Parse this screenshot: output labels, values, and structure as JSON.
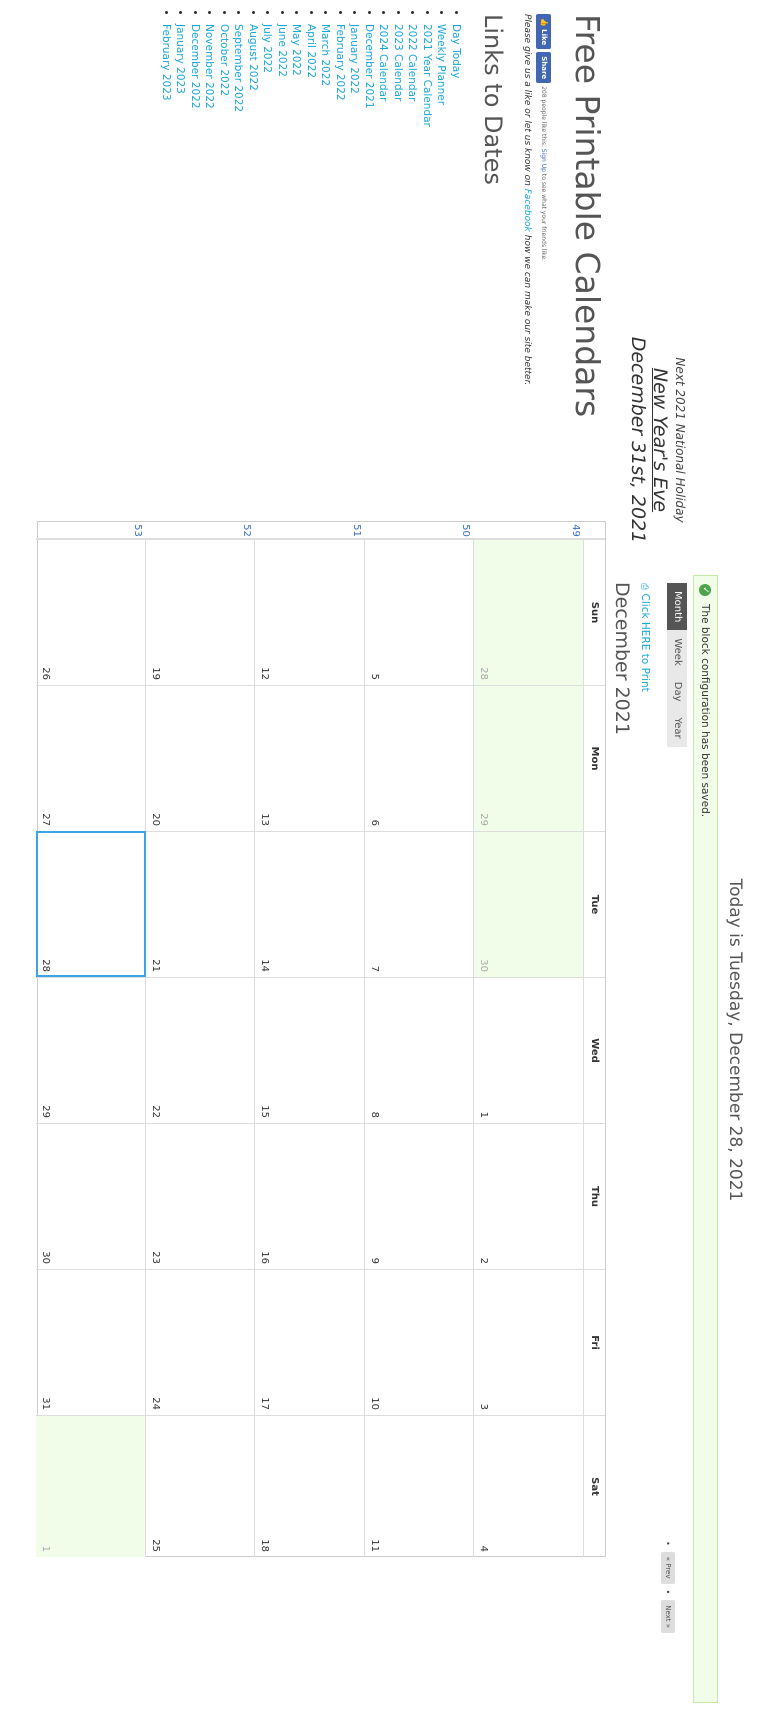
{
  "holiday": {
    "label": "Next 2021 National Holiday",
    "name": "New Year's Eve",
    "date": "December 31st, 2021"
  },
  "site_title": "Free Printable Calendars",
  "facebook": {
    "like_label": "Like",
    "share_label": "Share",
    "count_text": "208 people like this.",
    "signup_link": "Sign Up",
    "signup_suffix": "to see what your friends like."
  },
  "feedback": {
    "prefix": "Please give us a like or let us know on",
    "link": "Facebook",
    "suffix": "how we can make our site better."
  },
  "links_heading": "Links to Dates",
  "links": [
    "Day Today",
    "Weekly Planner",
    "2021 Year Calendar",
    "2022 Calendar",
    "2023 Calendar",
    "2024 Calendar",
    "December 2021",
    "January 2022",
    "February 2022",
    "March 2022",
    "April 2022",
    "May 2022",
    "June 2022",
    "July 2022",
    "August 2022",
    "September 2022",
    "October 2022",
    "November 2022",
    "December 2022",
    "January 2023",
    "February 2023"
  ],
  "today_text": "Today is Tuesday, December 28, 2021",
  "status_message": "The block configuration has been saved.",
  "view_tabs": [
    {
      "label": "Month",
      "active": true
    },
    {
      "label": "Week",
      "active": false
    },
    {
      "label": "Day",
      "active": false
    },
    {
      "label": "Year",
      "active": false
    }
  ],
  "pager": {
    "prev": "« Prev",
    "next": "Next »"
  },
  "print_link": "Click HERE to Print",
  "month_title": "December 2021",
  "calendar": {
    "days_of_week": [
      "Sun",
      "Mon",
      "Tue",
      "Wed",
      "Thu",
      "Fri",
      "Sat"
    ],
    "weeks": [
      {
        "week": "49",
        "days": [
          "28",
          "29",
          "30",
          "1",
          "2",
          "3",
          "4"
        ],
        "other": [
          true,
          true,
          true,
          false,
          false,
          false,
          false
        ]
      },
      {
        "week": "50",
        "days": [
          "5",
          "6",
          "7",
          "8",
          "9",
          "10",
          "11"
        ],
        "other": [
          false,
          false,
          false,
          false,
          false,
          false,
          false
        ]
      },
      {
        "week": "51",
        "days": [
          "12",
          "13",
          "14",
          "15",
          "16",
          "17",
          "18"
        ],
        "other": [
          false,
          false,
          false,
          false,
          false,
          false,
          false
        ]
      },
      {
        "week": "52",
        "days": [
          "19",
          "20",
          "21",
          "22",
          "23",
          "24",
          "25"
        ],
        "other": [
          false,
          false,
          false,
          false,
          false,
          false,
          false
        ]
      },
      {
        "week": "53",
        "days": [
          "26",
          "27",
          "28",
          "29",
          "30",
          "31",
          "1"
        ],
        "other": [
          false,
          false,
          false,
          false,
          false,
          false,
          true
        ]
      }
    ],
    "today": "28"
  },
  "colors": {
    "link": "#17a7d8",
    "highlight": "#f2fde9",
    "today_border": "#3aa5e0",
    "week_number": "#3b6fb7",
    "active_tab": "#555555"
  }
}
